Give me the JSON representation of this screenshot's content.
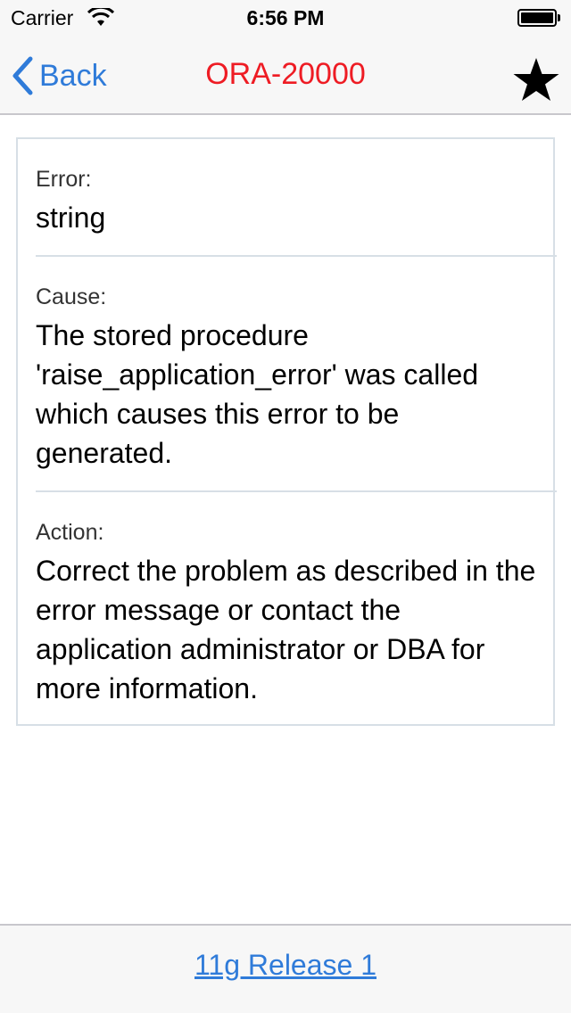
{
  "status_bar": {
    "carrier": "Carrier",
    "time": "6:56 PM",
    "wifi_icon": "wifi-icon",
    "battery_icon": "battery-icon"
  },
  "nav": {
    "back_label": "Back",
    "title": "ORA-20000",
    "title_color": "#ee1c24",
    "accent_color": "#2f7bd9",
    "favorite_icon": "star-icon"
  },
  "detail": {
    "error": {
      "label": "Error:",
      "value": "string"
    },
    "cause": {
      "label": "Cause:",
      "value": "The stored procedure 'raise_application_error' was called which causes this error to be generated."
    },
    "action": {
      "label": "Action:",
      "value": "Correct the problem as described in the error message or contact the application administrator or DBA for more information."
    }
  },
  "footer": {
    "release_link": "11g Release 1"
  }
}
